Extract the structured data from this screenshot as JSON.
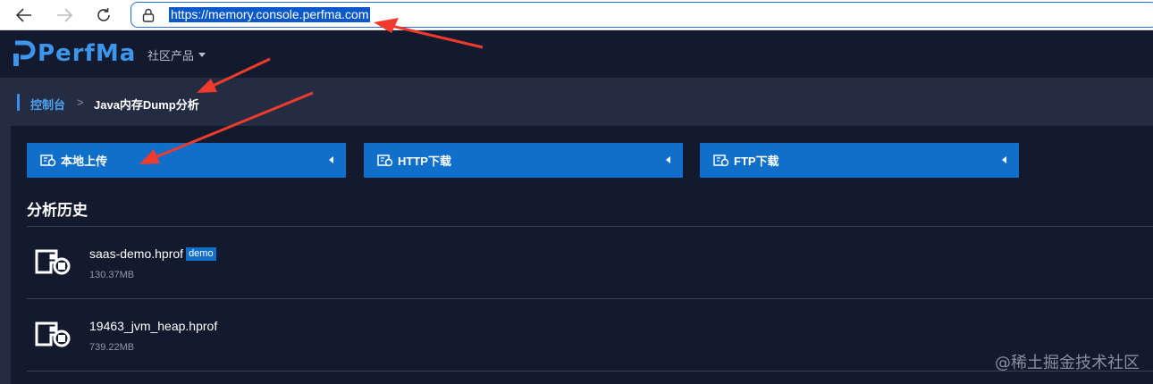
{
  "browser": {
    "url": "https://memory.console.perfma.com"
  },
  "header": {
    "logo_text": "PerfMa",
    "nav_products": "社区产品"
  },
  "breadcrumb": {
    "home": "控制台",
    "separator": ">",
    "current": "Java内存Dump分析"
  },
  "upload": {
    "local": "本地上传",
    "http": "HTTP下载",
    "ftp": "FTP下载"
  },
  "history": {
    "title": "分析历史",
    "items": [
      {
        "name": "saas-demo.hprof",
        "badge": "demo",
        "size": "130.37MB"
      },
      {
        "name": "19463_jvm_heap.hprof",
        "size": "739.22MB"
      }
    ]
  },
  "watermark": "@稀土掘金技术社区",
  "colors": {
    "accent": "#0f6fcb",
    "header_bg": "#131a2e",
    "band_bg": "#242c41",
    "annotation_arrow": "#f03a2e"
  }
}
